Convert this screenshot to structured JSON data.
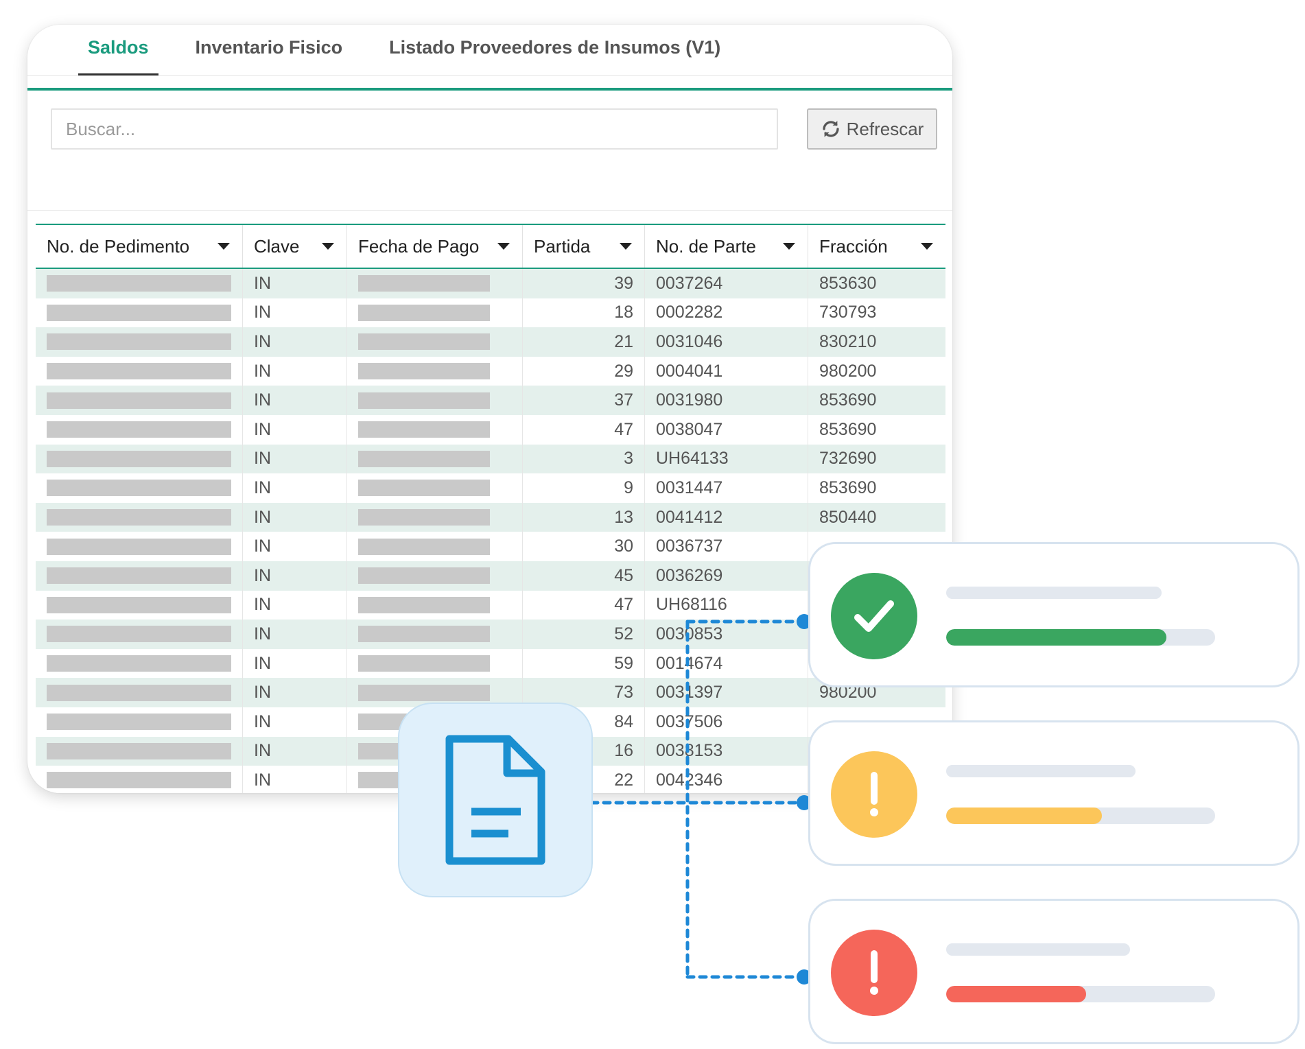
{
  "tabs": [
    {
      "label": "Saldos",
      "active": true
    },
    {
      "label": "Inventario Fisico",
      "active": false
    },
    {
      "label": "Listado Proveedores de Insumos (V1)",
      "active": false
    }
  ],
  "search": {
    "placeholder": "Buscar..."
  },
  "refresh": {
    "label": "Refrescar",
    "icon": "refresh-icon"
  },
  "table": {
    "columns": [
      "No. de Pedimento",
      "Clave",
      "Fecha de Pago",
      "Partida",
      "No. de Parte",
      "Fracción"
    ],
    "rows": [
      {
        "clave": "IN",
        "partida": "39",
        "parte": "0037264",
        "fraccion": "853630"
      },
      {
        "clave": "IN",
        "partida": "18",
        "parte": "0002282",
        "fraccion": "730793"
      },
      {
        "clave": "IN",
        "partida": "21",
        "parte": "0031046",
        "fraccion": "830210"
      },
      {
        "clave": "IN",
        "partida": "29",
        "parte": "0004041",
        "fraccion": "980200"
      },
      {
        "clave": "IN",
        "partida": "37",
        "parte": "0031980",
        "fraccion": "853690"
      },
      {
        "clave": "IN",
        "partida": "47",
        "parte": "0038047",
        "fraccion": "853690"
      },
      {
        "clave": "IN",
        "partida": "3",
        "parte": "UH64133",
        "fraccion": "732690"
      },
      {
        "clave": "IN",
        "partida": "9",
        "parte": "0031447",
        "fraccion": "853690"
      },
      {
        "clave": "IN",
        "partida": "13",
        "parte": "0041412",
        "fraccion": "850440"
      },
      {
        "clave": "IN",
        "partida": "30",
        "parte": "0036737",
        "fraccion": ""
      },
      {
        "clave": "IN",
        "partida": "45",
        "parte": "0036269",
        "fraccion": ""
      },
      {
        "clave": "IN",
        "partida": "47",
        "parte": "UH68116",
        "fraccion": ""
      },
      {
        "clave": "IN",
        "partida": "52",
        "parte": "0030853",
        "fraccion": ""
      },
      {
        "clave": "IN",
        "partida": "59",
        "parte": "0014674",
        "fraccion": ""
      },
      {
        "clave": "IN",
        "partida": "73",
        "parte": "0031397",
        "fraccion": "980200"
      },
      {
        "clave": "IN",
        "partida": "84",
        "parte": "0037506",
        "fraccion": ""
      },
      {
        "clave": "IN",
        "partida": "16",
        "parte": "0038153",
        "fraccion": ""
      },
      {
        "clave": "IN",
        "partida": "22",
        "parte": "0042346",
        "fraccion": ""
      }
    ]
  },
  "overlay": {
    "document_icon": "document-icon",
    "status_cards": [
      {
        "icon": "check-icon",
        "color": "#3aa660",
        "progress": 0.82
      },
      {
        "icon": "warning-icon",
        "color": "#fcc65a",
        "progress": 0.58
      },
      {
        "icon": "error-icon",
        "color": "#f5665a",
        "progress": 0.52
      }
    ],
    "accent_color": "#1e88d6"
  },
  "colors": {
    "brand": "#1a9b7e",
    "row_stripe": "#e4f0ec"
  }
}
